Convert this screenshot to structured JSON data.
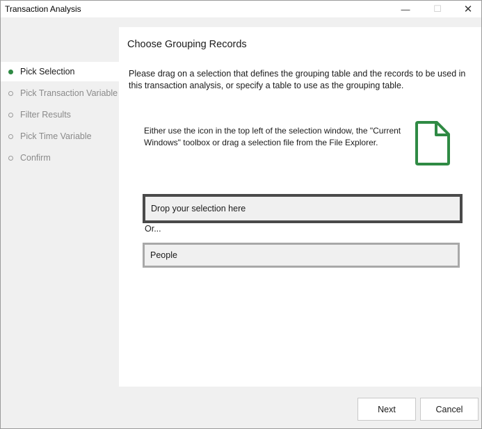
{
  "window": {
    "title": "Transaction Analysis",
    "controls": {
      "minimize": "—",
      "maximize": "☐",
      "close": "✕"
    }
  },
  "steps": [
    {
      "label": "Pick Selection",
      "active": true
    },
    {
      "label": "Pick Transaction Variable",
      "active": false
    },
    {
      "label": "Filter Results",
      "active": false
    },
    {
      "label": "Pick Time Variable",
      "active": false
    },
    {
      "label": "Confirm",
      "active": false
    }
  ],
  "main": {
    "title": "Choose Grouping Records",
    "intro": "Please drag on a selection that defines the grouping table and the records to be used in this transaction analysis, or specify a table to use as the grouping table.",
    "hint": "Either use the icon in the top left of the selection window, the \"Current Windows\" toolbox or drag a selection file from the File Explorer.",
    "icon": "file-icon",
    "drop_zone": "Drop your selection here",
    "or_label": "Or...",
    "table_value": "People"
  },
  "buttons": {
    "next": "Next",
    "cancel": "Cancel"
  },
  "colors": {
    "accent": "#2f8a44"
  }
}
